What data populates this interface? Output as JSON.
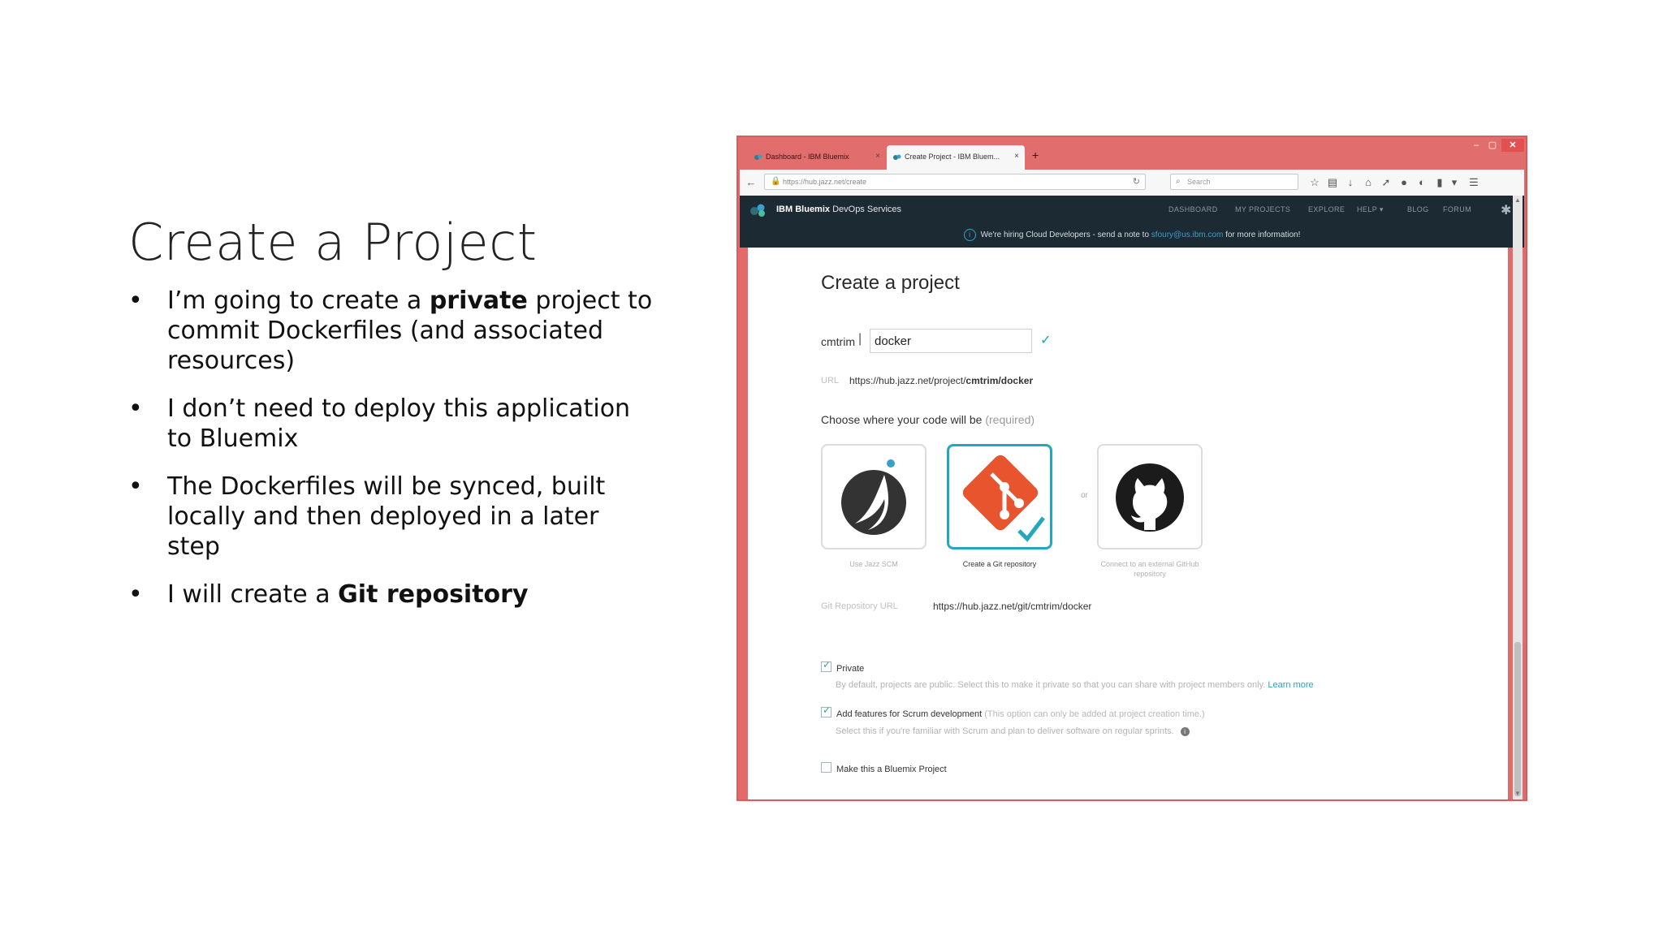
{
  "slide": {
    "title": "Create a Project",
    "bullets": [
      {
        "before": "I’m going to create a ",
        "bold": "private",
        "after": " project to commit Dockerfiles (and associated resources)"
      },
      {
        "before": "I don’t need to deploy this application to Bluemix",
        "bold": "",
        "after": ""
      },
      {
        "before": "The Dockerfiles will be synced, built locally and then deployed in a later step",
        "bold": "",
        "after": ""
      },
      {
        "before": "I will create a ",
        "bold": "Git repository",
        "after": ""
      }
    ]
  },
  "browser": {
    "tabs": [
      {
        "label": "Dashboard - IBM Bluemix"
      },
      {
        "label": "Create Project - IBM Bluem..."
      }
    ],
    "url": "https://hub.jazz.net/create",
    "search_placeholder": "Search",
    "window_controls": {
      "minimize": "–",
      "maximize": "▢",
      "close": "✕"
    }
  },
  "bluemix_nav": {
    "brand_bold": "IBM Bluemix",
    "brand_rest": " DevOps Services",
    "links": [
      "DASHBOARD",
      "MY PROJECTS",
      "EXPLORE",
      "HELP ▾",
      "BLOG",
      "FORUM"
    ]
  },
  "notice": {
    "before": "We're hiring Cloud Developers - send a note to ",
    "email": "sfoury@us.ibm.com",
    "after": " for more information!"
  },
  "form": {
    "title": "Create a project",
    "owner": "cmtrim",
    "project_name": "docker",
    "url_label": "URL",
    "url_prefix": "https://hub.jazz.net/project/",
    "url_path": "cmtrim/docker",
    "choose_label": "Choose where your code will be",
    "choose_required": "(required)",
    "options": [
      {
        "label": "Use Jazz SCM",
        "icon": "jazz-scm-icon"
      },
      {
        "label": "Create a Git repository",
        "icon": "git-icon",
        "selected": true
      },
      {
        "label": "Connect to an external GitHub repository",
        "icon": "github-icon"
      }
    ],
    "or_label": "or",
    "git_url_label": "Git Repository URL",
    "git_url": "https://hub.jazz.net/git/cmtrim/docker",
    "private_label": "Private",
    "private_checked": true,
    "private_desc": "By default, projects are public. Select this to make it private so that you can share with project members only.",
    "learn_more": "Learn more",
    "scrum_label": "Add features for Scrum development",
    "scrum_note": "(This option can only be added at project creation time.)",
    "scrum_checked": true,
    "scrum_desc": "Select this if you're familiar with Scrum and plan to deliver software on regular sprints.",
    "bluemix_label": "Make this a Bluemix Project",
    "bluemix_checked": false
  },
  "colors": {
    "window_frame": "#e36a6a",
    "nav_bg": "#1c2a33",
    "accent": "#23a6c0",
    "git_orange": "#e8542e"
  }
}
